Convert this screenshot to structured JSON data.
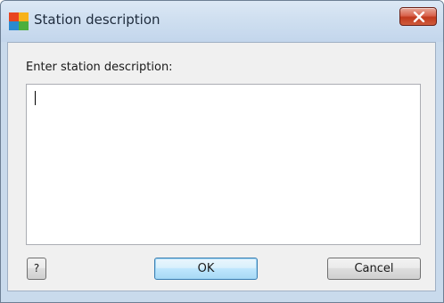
{
  "window": {
    "title": "Station description",
    "app_icon": "avg-logo-icon",
    "close_icon": "close-icon"
  },
  "dialog": {
    "prompt_label": "Enter station description:",
    "description_value": ""
  },
  "buttons": {
    "help_label": "?",
    "ok_label": "OK",
    "cancel_label": "Cancel"
  },
  "colors": {
    "titlebar": "#cfdff0",
    "close_button": "#c1391d",
    "client_background": "#f0f0f0",
    "default_button_border": "#3c7fb1"
  }
}
